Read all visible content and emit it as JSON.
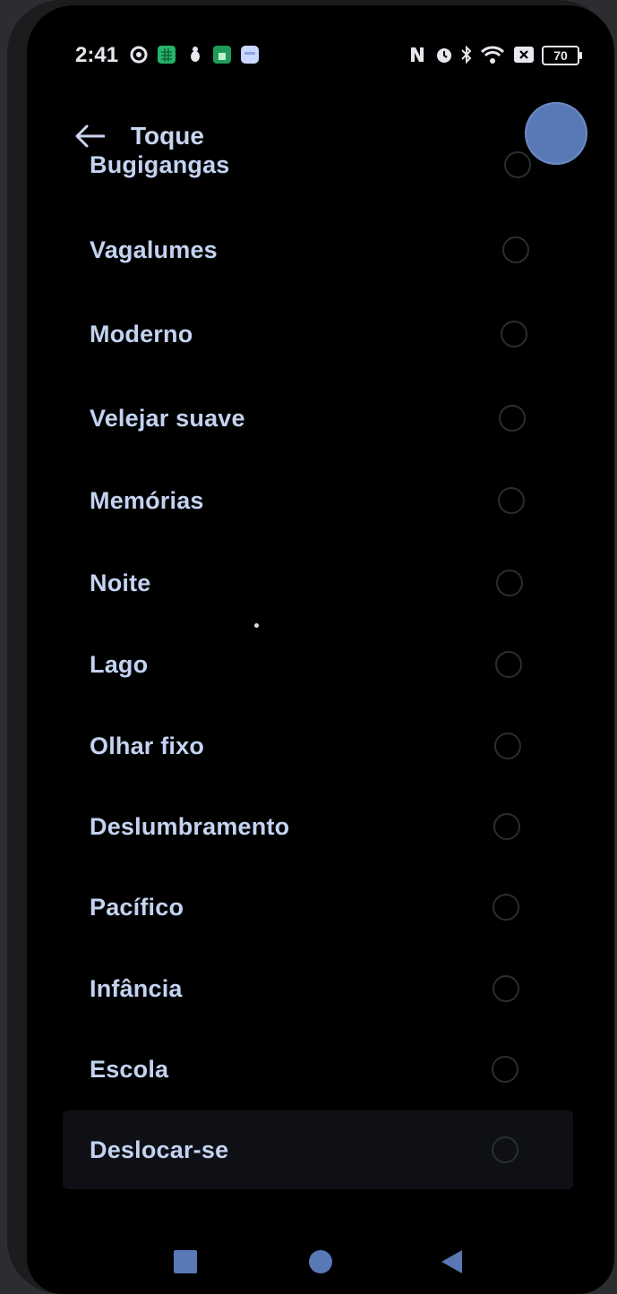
{
  "status_bar": {
    "time": "2:41",
    "battery": "70",
    "icons": [
      "gear-icon",
      "calendar-icon",
      "bug-icon",
      "sheet-icon",
      "message-icon",
      "nfc-icon",
      "alarm-icon",
      "bluetooth-icon",
      "wifi-icon",
      "no-sim-icon",
      "battery-icon"
    ]
  },
  "app_bar": {
    "title": "Toque",
    "back_icon": "arrow-left-icon"
  },
  "ringtones": [
    {
      "label": "Bugigangas"
    },
    {
      "label": "Vagalumes"
    },
    {
      "label": "Moderno"
    },
    {
      "label": "Velejar suave"
    },
    {
      "label": "Memórias"
    },
    {
      "label": "Noite"
    },
    {
      "label": "Lago"
    },
    {
      "label": "Olhar fixo"
    },
    {
      "label": "Deslumbramento"
    },
    {
      "label": "Pacífico"
    },
    {
      "label": "Infância"
    },
    {
      "label": "Escola"
    },
    {
      "label": "Deslocar-se"
    }
  ],
  "nav_bar": {
    "icons": [
      "recents-square-icon",
      "home-circle-icon",
      "back-triangle-icon"
    ]
  },
  "colors": {
    "accent": "#5879b6",
    "text": "#c3d3f1",
    "background": "#000000"
  }
}
